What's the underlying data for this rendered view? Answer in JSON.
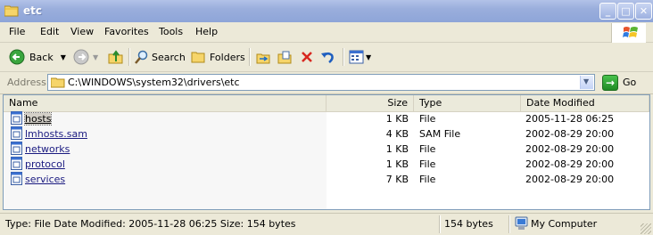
{
  "window": {
    "title": "etc"
  },
  "menu": [
    "File",
    "Edit",
    "View",
    "Favorites",
    "Tools",
    "Help"
  ],
  "toolbar": {
    "back_label": "Back",
    "search_label": "Search",
    "folders_label": "Folders"
  },
  "address": {
    "label": "Address",
    "path": "C:\\WINDOWS\\system32\\drivers\\etc",
    "go_label": "Go"
  },
  "columns": {
    "name": "Name",
    "size": "Size",
    "type": "Type",
    "date": "Date Modified"
  },
  "files": [
    {
      "name": "hosts",
      "size": "1 KB",
      "type": "File",
      "date": "2005-11-28 06:25",
      "selected": true
    },
    {
      "name": "lmhosts.sam",
      "size": "4 KB",
      "type": "SAM File",
      "date": "2002-08-29 20:00"
    },
    {
      "name": "networks",
      "size": "1 KB",
      "type": "File",
      "date": "2002-08-29 20:00"
    },
    {
      "name": "protocol",
      "size": "1 KB",
      "type": "File",
      "date": "2002-08-29 20:00"
    },
    {
      "name": "services",
      "size": "7 KB",
      "type": "File",
      "date": "2002-08-29 20:00"
    }
  ],
  "status": {
    "details": "Type: File Date Modified: 2005-11-28 06:25 Size: 154 bytes",
    "size": "154 bytes",
    "location": "My Computer"
  }
}
